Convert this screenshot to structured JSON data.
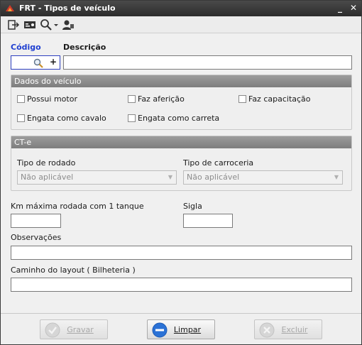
{
  "window": {
    "title": "FRT - Tipos de veículo",
    "controls": {
      "minimize": "_",
      "close": "✕"
    }
  },
  "toolbar": {
    "icons": [
      "exit-icon",
      "card-icon",
      "search-icon",
      "user-icon"
    ]
  },
  "form": {
    "codigo_label": "Código",
    "descricao_label": "Descrição",
    "codigo_value": "",
    "descricao_value": "",
    "codigo_plus": "+"
  },
  "dados_veiculo": {
    "title": "Dados do veículo",
    "checkboxes": [
      {
        "label": "Possui motor",
        "checked": false
      },
      {
        "label": "Faz aferição",
        "checked": false
      },
      {
        "label": "Faz capacitação",
        "checked": false
      },
      {
        "label": "Engata como cavalo",
        "checked": false
      },
      {
        "label": "Engata como carreta",
        "checked": false
      }
    ]
  },
  "cte": {
    "title": "CT-e",
    "tipo_rodado_label": "Tipo de rodado",
    "tipo_rodado_value": "Não aplicável",
    "tipo_carroceria_label": "Tipo de carroceria",
    "tipo_carroceria_value": "Não aplicável"
  },
  "extra": {
    "km_label": "Km máxima rodada com 1 tanque",
    "km_value": "",
    "sigla_label": "Sigla",
    "sigla_value": "",
    "observacoes_label": "Observações",
    "observacoes_value": "",
    "caminho_label": "Caminho do layout ( Bilheteria )",
    "caminho_value": ""
  },
  "footer": {
    "gravar": "Gravar",
    "limpar": "Limpar",
    "excluir": "Excluir"
  },
  "colors": {
    "accent_blue": "#1f3fd1",
    "group_header": "#8c8c8c",
    "limpar_icon": "#2b72d6"
  }
}
